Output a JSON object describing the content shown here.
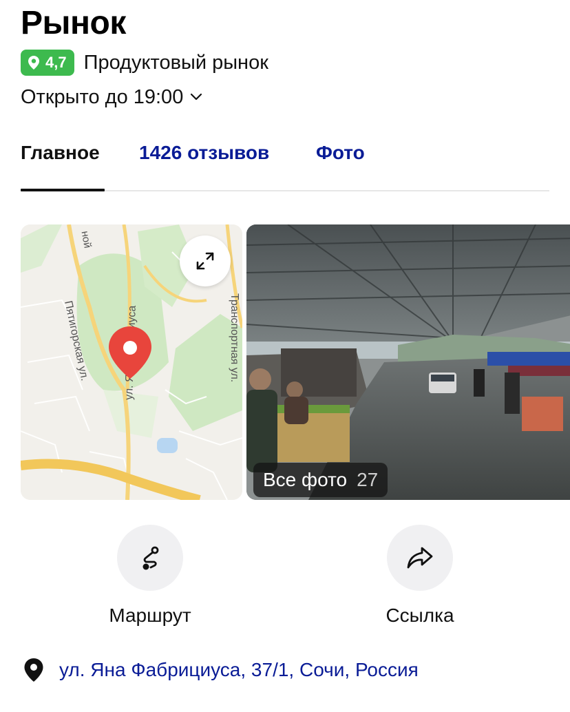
{
  "header": {
    "title": "Рынок",
    "rating": "4,7",
    "category": "Продуктовый рынок",
    "hours": "Открыто до 19:00"
  },
  "tabs": [
    {
      "label": "Главное",
      "active": true
    },
    {
      "label": "1426 отзывов",
      "active": false
    },
    {
      "label": "Фото",
      "active": false
    }
  ],
  "map": {
    "streets": {
      "pyatigorskaya": "Пятигорская ул.",
      "fabritsiusa": "ул. Я. Фабрициуса",
      "transportnaya": "Транспортная ул.",
      "top_fragment": "ной"
    }
  },
  "photos": {
    "all_label": "Все фото",
    "count": "27"
  },
  "actions": {
    "route_label": "Маршрут",
    "share_label": "Ссылка"
  },
  "address": "ул. Яна Фабрициуса, 37/1, Сочи, Россия",
  "colors": {
    "rating_green": "#3dba4e",
    "link_blue": "#0a1c96",
    "pin_red": "#e8453c"
  }
}
